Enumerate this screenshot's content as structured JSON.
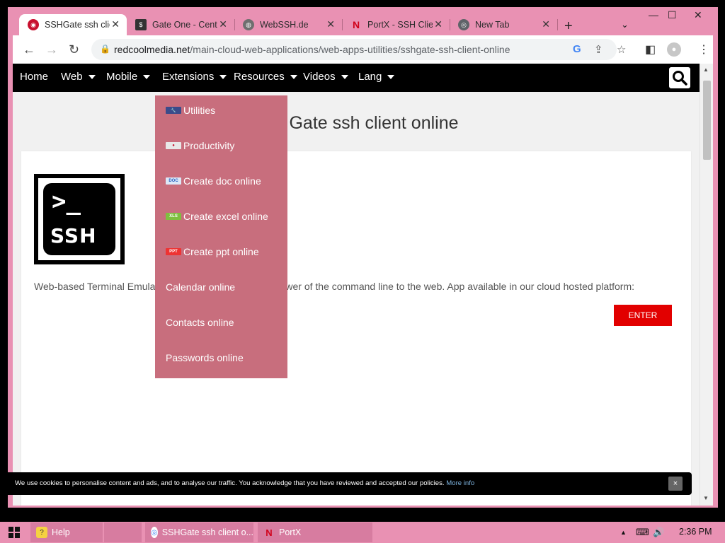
{
  "browser": {
    "tabs": [
      {
        "title": "SSHGate ssh client online",
        "active": true
      },
      {
        "title": "Gate One - Central",
        "active": false
      },
      {
        "title": "WebSSH.de",
        "active": false
      },
      {
        "title": "PortX - SSH Client",
        "active": false
      },
      {
        "title": "New Tab",
        "active": false
      }
    ],
    "window_controls": {
      "minimize": "—",
      "maximize": "☐",
      "close": "✕"
    },
    "url_host": "redcoolmedia.net",
    "url_path": "/main-cloud-web-applications/web-apps-utilities/sshgate-ssh-client-online"
  },
  "site": {
    "nav": [
      {
        "label": "Home",
        "has_caret": false
      },
      {
        "label": "Web",
        "has_caret": true
      },
      {
        "label": "Mobile",
        "has_caret": true
      },
      {
        "label": "Extensions",
        "has_caret": true
      },
      {
        "label": "Resources",
        "has_caret": true
      },
      {
        "label": "Videos",
        "has_caret": true
      },
      {
        "label": "Lang",
        "has_caret": true
      }
    ],
    "dropdown": [
      {
        "label": "Utilities",
        "icon": "utilities-icon",
        "badge": "🔧"
      },
      {
        "label": "Productivity",
        "icon": "productivity-icon",
        "badge": "●"
      },
      {
        "label": "Create doc online",
        "icon": "doc-icon",
        "badge": "DOC"
      },
      {
        "label": "Create excel online",
        "icon": "xls-icon",
        "badge": "XLS"
      },
      {
        "label": "Create ppt online",
        "icon": "ppt-icon",
        "badge": "PPT"
      },
      {
        "label": "Calendar online",
        "icon": "",
        "badge": ""
      },
      {
        "label": "Contacts online",
        "icon": "",
        "badge": ""
      },
      {
        "label": "Passwords online",
        "icon": "",
        "badge": ""
      }
    ],
    "title_visible": "Gate ssh client online",
    "logo_prompt": ">_",
    "logo_text": "SSH",
    "description_start": "Web-based Terminal Emulat",
    "description_end": "he power of the command line to the web. App available in our cloud hosted platform:",
    "enter_label": "ENTER",
    "cookie_text": "We use cookies to personalise content and ads, and to analyse our traffic. You acknowledge that you have reviewed and accepted our policies.",
    "cookie_link": "More info",
    "cookie_close": "×"
  },
  "taskbar": {
    "items": [
      {
        "label": "Help"
      },
      {
        "label": "SSHGate ssh client o..."
      },
      {
        "label": "PortX"
      }
    ],
    "clock": "2:36 PM"
  },
  "colors": {
    "accent_pink": "#e991b3",
    "dropdown_bg": "#c86e7d",
    "enter_red": "#e20000"
  }
}
